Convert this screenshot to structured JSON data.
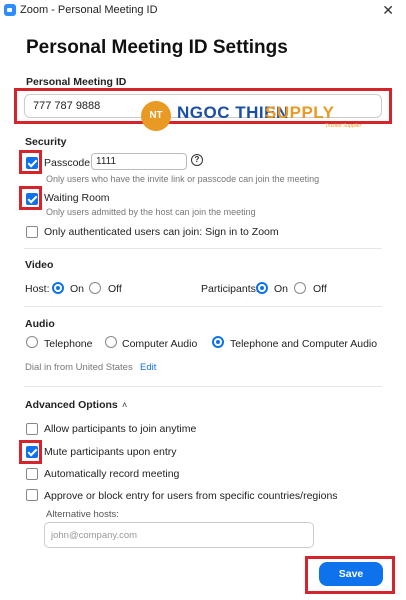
{
  "window": {
    "title": "Zoom - Personal Meeting ID",
    "close_glyph": "✕"
  },
  "page_title": "Personal Meeting ID Settings",
  "pmi": {
    "label": "Personal Meeting ID",
    "value": "777 787 9888"
  },
  "watermark": {
    "mark": "NT",
    "word1": "NGOC THIEN",
    "word2": "SUPPLY",
    "tagline": "Trusted Supplier"
  },
  "security": {
    "heading": "Security",
    "passcode": {
      "label": "Passcode",
      "value": "1111",
      "checked": true,
      "help": "?"
    },
    "passcode_hint": "Only users who have the invite link or passcode can join the meeting",
    "waiting_room": {
      "label": "Waiting Room",
      "checked": true
    },
    "waiting_room_hint": "Only users admitted by the host can join the meeting",
    "auth_only": {
      "label": "Only authenticated users can join: Sign in to Zoom",
      "checked": false
    }
  },
  "video": {
    "heading": "Video",
    "host_label": "Host:",
    "participants_label": "Participants:",
    "on_label": "On",
    "off_label": "Off",
    "host_value": "On",
    "participants_value": "On"
  },
  "audio": {
    "heading": "Audio",
    "options": [
      "Telephone",
      "Computer Audio",
      "Telephone and Computer Audio"
    ],
    "selected": "Telephone and Computer Audio",
    "dial_in": "Dial in from United States",
    "edit_link": "Edit"
  },
  "advanced": {
    "heading": "Advanced Options",
    "chevron": "˄",
    "options": [
      {
        "label": "Allow participants to join anytime",
        "checked": false
      },
      {
        "label": "Mute participants upon entry",
        "checked": true
      },
      {
        "label": "Automatically record meeting",
        "checked": false
      },
      {
        "label": "Approve or block entry for users from specific countries/regions",
        "checked": false
      }
    ],
    "alt_hosts_label": "Alternative hosts:",
    "alt_hosts_placeholder": "john@company.com"
  },
  "save_label": "Save",
  "colors": {
    "accent": "#0e72ed",
    "highlight_border": "#d4242c"
  }
}
